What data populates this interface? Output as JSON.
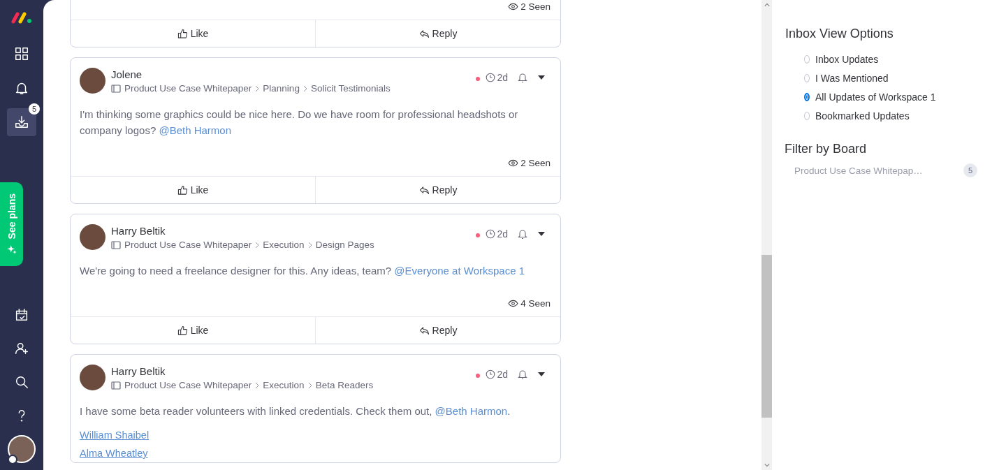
{
  "sidebar": {
    "items": [
      {
        "kind": "grid",
        "selected": false
      },
      {
        "kind": "bell",
        "selected": false
      },
      {
        "kind": "inbox",
        "selected": true,
        "badge": "5"
      }
    ],
    "promo": {
      "label": "See plans"
    },
    "bottom_items": [
      {
        "kind": "calendar",
        "selected": false
      },
      {
        "kind": "invite",
        "selected": false
      },
      {
        "kind": "search",
        "selected": false
      },
      {
        "kind": "help",
        "selected": false
      },
      {
        "kind": "avatar"
      }
    ]
  },
  "feed": [
    {
      "kind": "partial",
      "seen": "2 Seen",
      "actions": [
        "Like",
        "Reply"
      ]
    },
    {
      "kind": "post",
      "author": "Jolene",
      "breadcrumb": [
        "Product Use Case Whitepaper",
        "Planning",
        "Solicit Testimonials"
      ],
      "unread": true,
      "time": "2d",
      "body": [
        {
          "kind": "text",
          "text": "I'm thinking some graphics could be nice here. Do we have room for professional headshots or company logos? "
        },
        {
          "kind": "mention",
          "text": "@Beth Harmon"
        }
      ],
      "seen": "2 Seen",
      "actions": [
        "Like",
        "Reply"
      ]
    },
    {
      "kind": "post",
      "author": "Harry Beltik",
      "breadcrumb": [
        "Product Use Case Whitepaper",
        "Execution",
        "Design Pages"
      ],
      "unread": true,
      "time": "2d",
      "body": [
        {
          "kind": "text",
          "text": "We're going to need a freelance designer for this. Any ideas, team? "
        },
        {
          "kind": "mention",
          "text": "@Everyone at Workspace 1"
        }
      ],
      "seen": "4 Seen",
      "actions": [
        "Like",
        "Reply"
      ]
    },
    {
      "kind": "post",
      "author": "Harry Beltik",
      "breadcrumb": [
        "Product Use Case Whitepaper",
        "Execution",
        "Beta Readers"
      ],
      "unread": true,
      "time": "2d",
      "body": [
        {
          "kind": "text",
          "text": "I have some beta reader volunteers with linked credentials. Check them out, "
        },
        {
          "kind": "mention",
          "text": "@Beth Harmon"
        },
        {
          "kind": "text",
          "text": "."
        }
      ],
      "links": [
        "William Shaibel",
        "Alma Wheatley"
      ]
    }
  ],
  "view_options": {
    "title": "Inbox View Options",
    "options": [
      {
        "label": "Inbox Updates",
        "selected": false
      },
      {
        "label": "I Was Mentioned",
        "selected": false
      },
      {
        "label": "All Updates of Workspace 1",
        "selected": true
      },
      {
        "label": "Bookmarked Updates",
        "selected": false
      }
    ]
  },
  "filter": {
    "title": "Filter by Board",
    "boards": [
      {
        "label": "Product Use Case Whitepap…",
        "count": "5"
      }
    ]
  }
}
